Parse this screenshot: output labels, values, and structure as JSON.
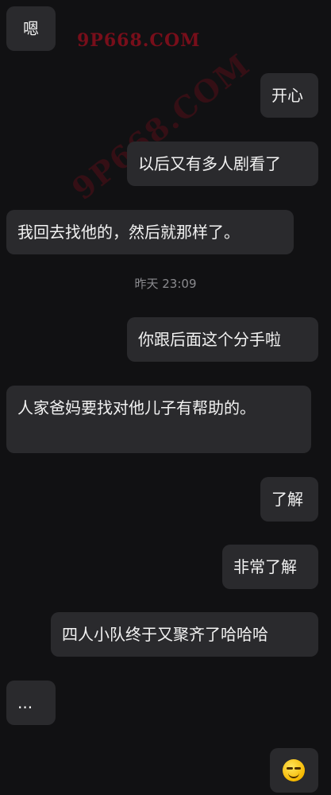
{
  "watermark": {
    "top_text": "9P668.COM",
    "diagonal_text": "9P668.COM"
  },
  "messages": [
    {
      "side": "left",
      "text": "嗯"
    },
    {
      "side": "right",
      "text": "开心"
    },
    {
      "side": "right",
      "text": "以后又有多人剧看了"
    },
    {
      "side": "left",
      "text": "我回去找他的，然后就那样了。"
    },
    {
      "side": "right",
      "text": "你跟后面这个分手啦"
    },
    {
      "side": "left",
      "text": "人家爸妈要找对他儿子有帮助的。"
    },
    {
      "side": "right",
      "text": "了解"
    },
    {
      "side": "right",
      "text": "非常了解"
    },
    {
      "side": "right",
      "text": "四人小队终于又聚齐了哈哈哈"
    },
    {
      "side": "left",
      "text": "..."
    },
    {
      "side": "right",
      "emoji": "grinning-face-emoji"
    }
  ],
  "timestamp": "昨天 23:09"
}
